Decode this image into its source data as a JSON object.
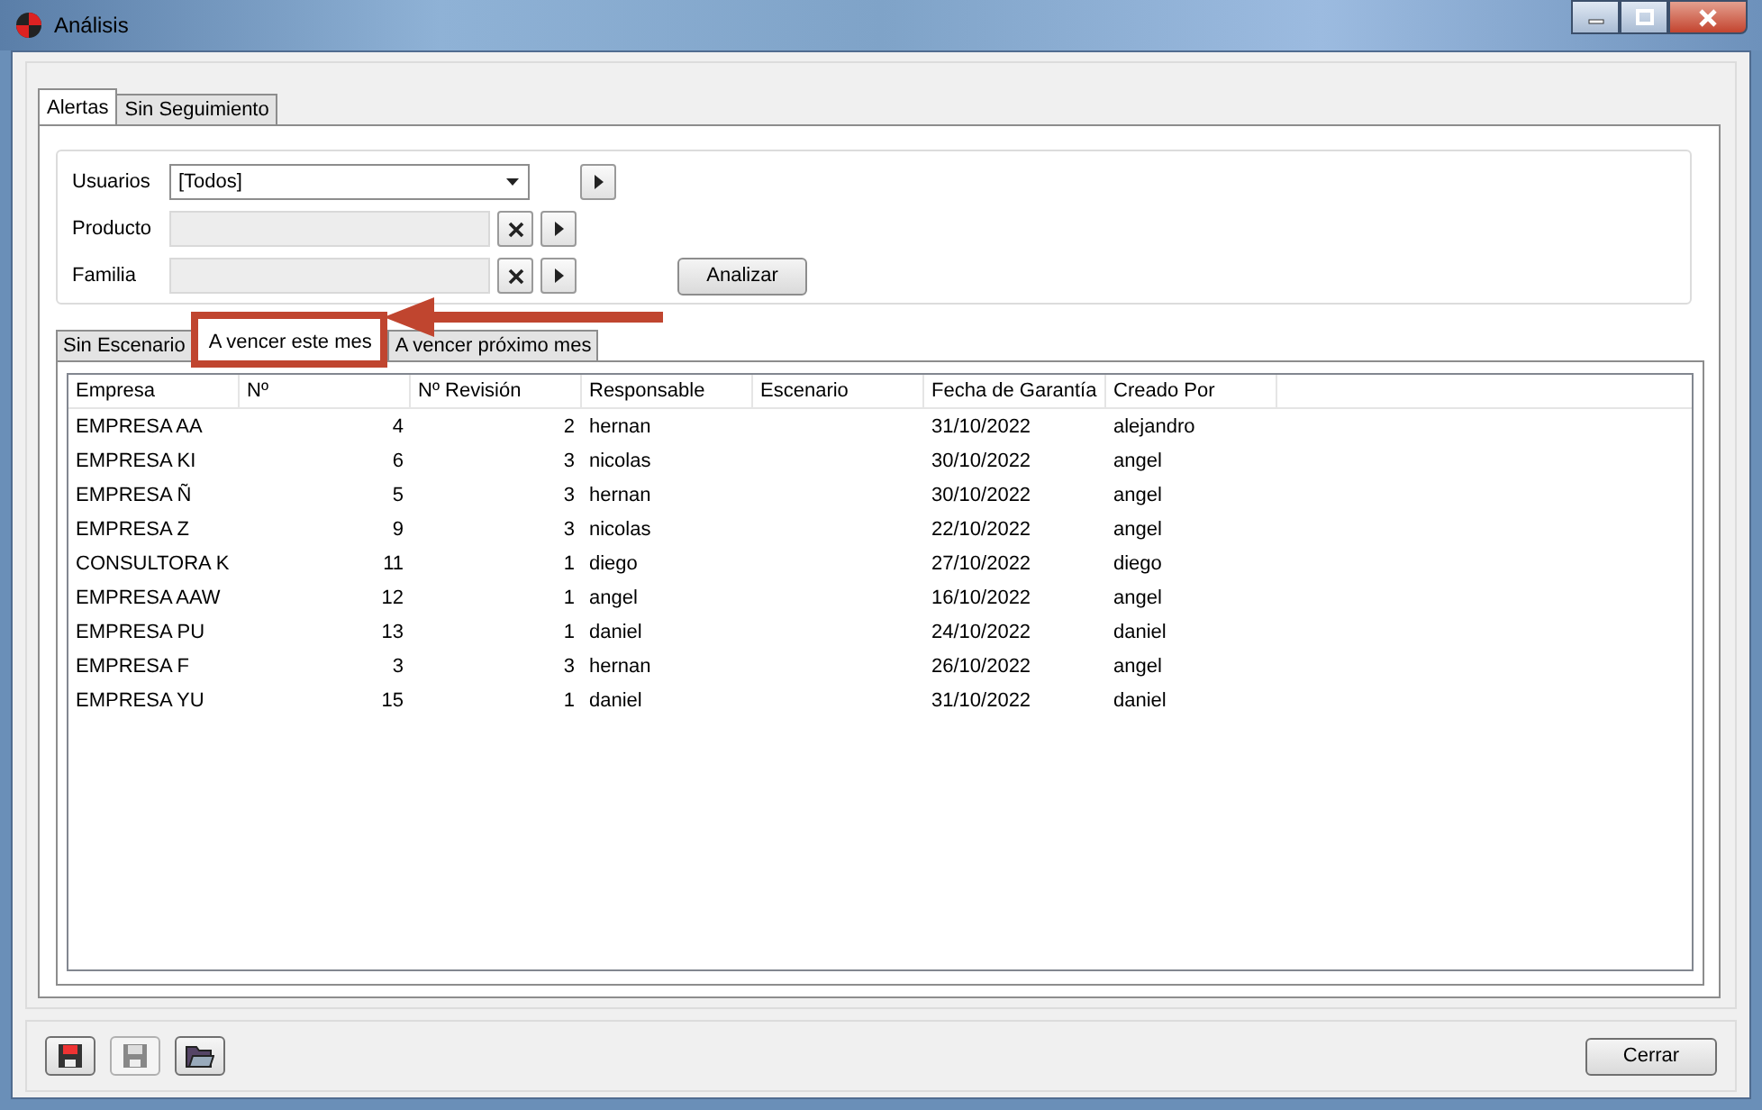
{
  "window": {
    "title": "Análisis"
  },
  "tabs": [
    {
      "label": "Alertas",
      "selected": true
    },
    {
      "label": "Sin Seguimiento",
      "selected": false
    }
  ],
  "filters": [
    {
      "label": "Usuarios",
      "kind": "dropdown",
      "value": "[Todos]"
    },
    {
      "label": "Producto",
      "kind": "picker"
    },
    {
      "label": "Familia",
      "kind": "picker"
    }
  ],
  "analyze_button": "Analizar",
  "result_tabs": [
    {
      "label": "Sin Escenario",
      "selected": false,
      "highlighted": false
    },
    {
      "label": "A vencer este mes",
      "selected": true,
      "highlighted": true
    },
    {
      "label": "A vencer próximo mes",
      "selected": false,
      "highlighted": false
    }
  ],
  "table": {
    "columns": [
      {
        "label": "Empresa",
        "kind": "text"
      },
      {
        "label": "Nº",
        "kind": "number"
      },
      {
        "label": "Nº Revisión",
        "kind": "number"
      },
      {
        "label": "Responsable",
        "kind": "text"
      },
      {
        "label": "Escenario",
        "kind": "text"
      },
      {
        "label": "Fecha de Garantía",
        "kind": "text"
      },
      {
        "label": "Creado Por",
        "kind": "text"
      }
    ],
    "rows": [
      [
        "EMPRESA AA",
        "4",
        "2",
        "hernan",
        "",
        "31/10/2022",
        "alejandro"
      ],
      [
        "EMPRESA KI",
        "6",
        "3",
        "nicolas",
        "",
        "30/10/2022",
        "angel"
      ],
      [
        "EMPRESA Ñ",
        "5",
        "3",
        "hernan",
        "",
        "30/10/2022",
        "angel"
      ],
      [
        "EMPRESA Z",
        "9",
        "3",
        "nicolas",
        "",
        "22/10/2022",
        "angel"
      ],
      [
        "CONSULTORA K",
        "11",
        "1",
        "diego",
        "",
        "27/10/2022",
        "diego"
      ],
      [
        "EMPRESA AAW",
        "12",
        "1",
        "angel",
        "",
        "16/10/2022",
        "angel"
      ],
      [
        "EMPRESA PU",
        "13",
        "1",
        "daniel",
        "",
        "24/10/2022",
        "daniel"
      ],
      [
        "EMPRESA F",
        "3",
        "3",
        "hernan",
        "",
        "26/10/2022",
        "angel"
      ],
      [
        "EMPRESA YU",
        "15",
        "1",
        "daniel",
        "",
        "31/10/2022",
        "daniel"
      ]
    ]
  },
  "toolbar": [
    {
      "kind": "save",
      "disabled": false
    },
    {
      "kind": "save",
      "disabled": true
    },
    {
      "kind": "open",
      "disabled": false
    }
  ],
  "close_button": "Cerrar"
}
